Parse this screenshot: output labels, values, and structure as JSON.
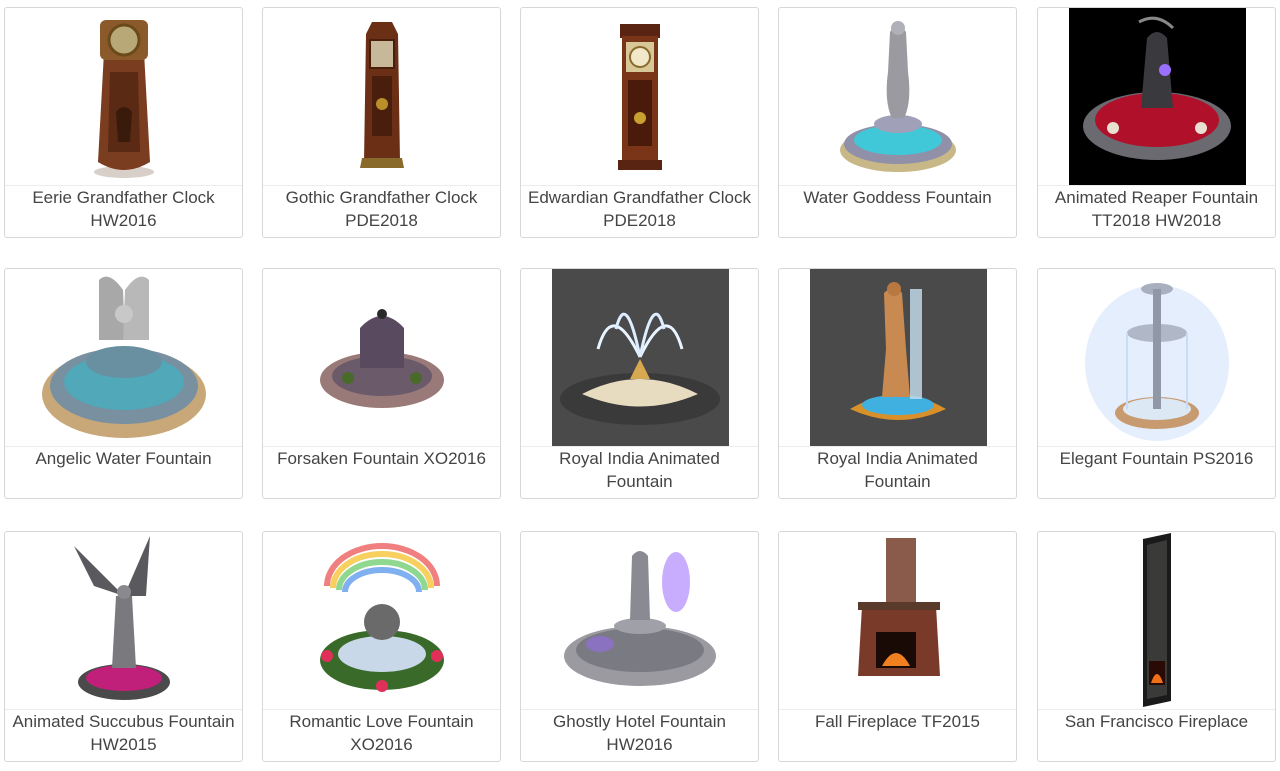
{
  "items": [
    {
      "title": "Eerie Grandfather Clock HW2016",
      "image": "eerie-grandfather-clock"
    },
    {
      "title": "Gothic Grandfather Clock PDE2018",
      "image": "gothic-grandfather-clock"
    },
    {
      "title": "Edwardian Grandfather Clock PDE2018",
      "image": "edwardian-grandfather-clock"
    },
    {
      "title": "Water Goddess Fountain",
      "image": "water-goddess-fountain"
    },
    {
      "title": "Animated Reaper Fountain TT2018 HW2018",
      "image": "reaper-fountain"
    },
    {
      "title": "Angelic Water Fountain",
      "image": "angelic-fountain"
    },
    {
      "title": "Forsaken Fountain XO2016",
      "image": "forsaken-fountain"
    },
    {
      "title": "Royal India Animated Fountain",
      "image": "royal-india-lotus-fountain"
    },
    {
      "title": "Royal India Animated Fountain",
      "image": "royal-india-statue-fountain"
    },
    {
      "title": "Elegant Fountain PS2016",
      "image": "elegant-fountain"
    },
    {
      "title": "Animated Succubus Fountain HW2015",
      "image": "succubus-fountain"
    },
    {
      "title": "Romantic Love Fountain XO2016",
      "image": "romantic-love-fountain"
    },
    {
      "title": "Ghostly Hotel Fountain HW2016",
      "image": "ghostly-fountain"
    },
    {
      "title": "Fall Fireplace TF2015",
      "image": "fall-fireplace"
    },
    {
      "title": "San Francisco Fireplace",
      "image": "san-francisco-fireplace"
    }
  ]
}
